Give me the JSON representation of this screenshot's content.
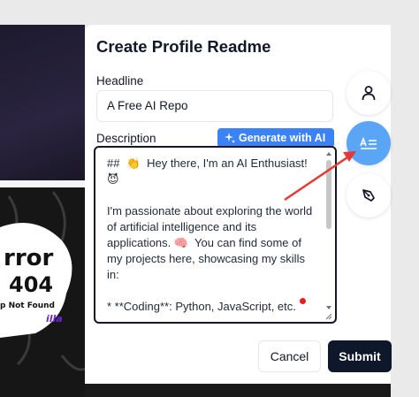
{
  "dialog": {
    "title": "Create Profile Readme",
    "headline_label": "Headline",
    "headline_value": "A Free AI Repo",
    "description_label": "Description",
    "generate_button": "Generate with AI",
    "description_value": "##  👏  Hey there, I'm an AI Enthusiast! 😈\n\nI'm passionate about exploring the world of artificial intelligence and its applications. 🧠  You can find some of my projects here, showcasing my skills in:\n\n* **Coding**: Python, JavaScript, etc.\n—",
    "cancel_button": "Cancel",
    "submit_button": "Submit"
  },
  "side_toolbar": {
    "items": [
      {
        "icon": "user-icon"
      },
      {
        "icon": "text-align-icon",
        "active": true
      },
      {
        "icon": "pen-tool-icon"
      }
    ]
  },
  "background": {
    "art_text_1": "rror",
    "art_text_2": "404",
    "art_text_3": "p Not Found",
    "art_badge": "illa"
  },
  "colors": {
    "accent": "#3b82f6",
    "active_tool": "#5aa5f5",
    "submit": "#0f172a",
    "annotation_arrow": "#e53935"
  }
}
